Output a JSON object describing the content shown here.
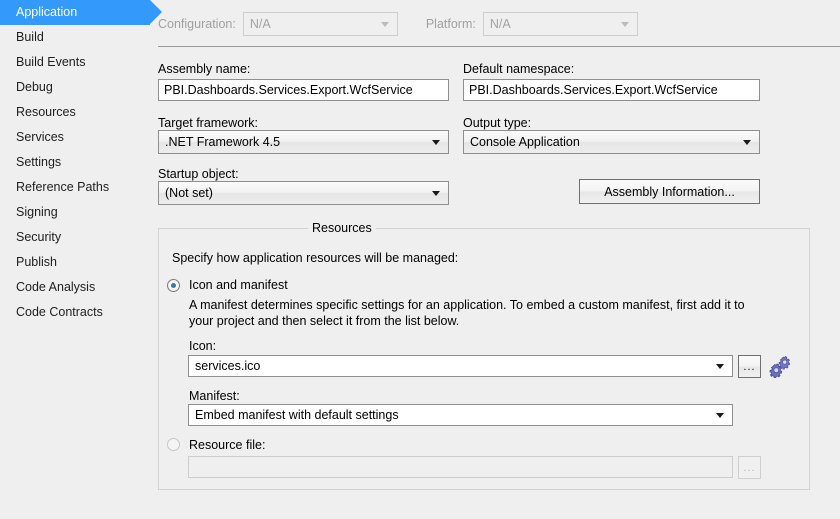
{
  "sidebar": {
    "items": [
      {
        "label": "Application",
        "selected": true
      },
      {
        "label": "Build",
        "selected": false
      },
      {
        "label": "Build Events",
        "selected": false
      },
      {
        "label": "Debug",
        "selected": false
      },
      {
        "label": "Resources",
        "selected": false
      },
      {
        "label": "Services",
        "selected": false
      },
      {
        "label": "Settings",
        "selected": false
      },
      {
        "label": "Reference Paths",
        "selected": false
      },
      {
        "label": "Signing",
        "selected": false
      },
      {
        "label": "Security",
        "selected": false
      },
      {
        "label": "Publish",
        "selected": false
      },
      {
        "label": "Code Analysis",
        "selected": false
      },
      {
        "label": "Code Contracts",
        "selected": false
      }
    ]
  },
  "toolbar": {
    "configuration_label": "Configuration:",
    "configuration_value": "N/A",
    "platform_label": "Platform:",
    "platform_value": "N/A"
  },
  "application": {
    "assembly_name_label": "Assembly name:",
    "assembly_name_value": "PBI.Dashboards.Services.Export.WcfService",
    "default_namespace_label": "Default namespace:",
    "default_namespace_value": "PBI.Dashboards.Services.Export.WcfService",
    "target_framework_label": "Target framework:",
    "target_framework_value": ".NET Framework 4.5",
    "output_type_label": "Output type:",
    "output_type_value": "Console Application",
    "startup_object_label": "Startup object:",
    "startup_object_value": "(Not set)",
    "assembly_information_button": "Assembly Information..."
  },
  "resources": {
    "group_title": "Resources",
    "intro": "Specify how application resources will be managed:",
    "icon_manifest_option": "Icon and manifest",
    "manifest_description_line1": "A manifest determines specific settings for an application. To embed a custom manifest, first add it to",
    "manifest_description_line2": "your project and then select it from the list below.",
    "icon_label": "Icon:",
    "icon_value": "services.ico",
    "icon_browse_button": "...",
    "icon_preview_name": "gears-icon",
    "manifest_label": "Manifest:",
    "manifest_value": "Embed manifest with default settings",
    "resource_file_option": "Resource file:",
    "resource_file_value": "",
    "resource_file_browse_button": "..."
  },
  "colors": {
    "selection_blue": "#3399fa",
    "panel_background": "#efeff0",
    "radio_accent": "#2d7dac",
    "gear_purple": "#6a6fc0"
  }
}
